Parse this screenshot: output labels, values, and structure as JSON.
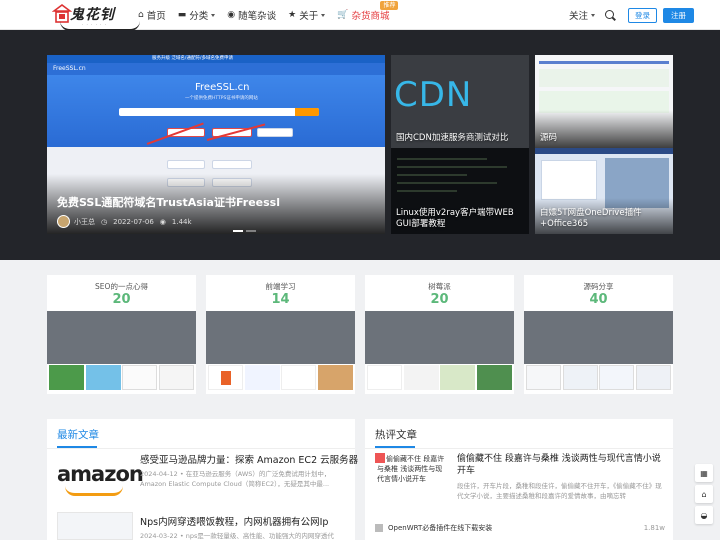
{
  "header": {
    "brand": "鬼花钊",
    "brand_sub": "· · · · · ·",
    "nav": [
      {
        "label": "首页",
        "icon": "home-icon",
        "glyph": "⌂"
      },
      {
        "label": "分类",
        "icon": "folder-icon",
        "glyph": "▬"
      },
      {
        "label": "随笔杂谈",
        "icon": "compass-icon",
        "glyph": "◉"
      },
      {
        "label": "关于",
        "icon": "star-icon",
        "glyph": "★"
      },
      {
        "label": "杂货商城",
        "icon": "cart-icon",
        "glyph": "🛒",
        "badge": "推荐"
      }
    ],
    "follow_label": "关注",
    "login_label": "登录",
    "register_label": "注册"
  },
  "hero": {
    "main": {
      "title": "免费SSL通配符域名TrustAsia证书Freessl",
      "author": "小王总",
      "date": "2022-07-06",
      "views": "1.44k",
      "site_name": "FreeSSL.cn",
      "banner_title": "FreeSSL.cn",
      "banner_tagline": "一个提供免费HTTPS证书申请的网站",
      "topbar_text": "服务升级 泛域名/通配符/多域名免费申请"
    },
    "tiles": [
      {
        "caption": "国内CDN加速服务商测试对比",
        "logo_text": "CDN"
      },
      {
        "caption": "源码"
      },
      {
        "caption": "Linux使用v2ray客户端带WEB GUI部署教程"
      },
      {
        "caption": "白嫖5T网盘OneDrive插件+Office365"
      }
    ]
  },
  "categories": [
    {
      "name": "SEO的一点心得",
      "count": "20"
    },
    {
      "name": "前端学习",
      "count": "14"
    },
    {
      "name": "树莓派",
      "count": "20"
    },
    {
      "name": "源码分享",
      "count": "40"
    }
  ],
  "latest": {
    "title": "最新文章",
    "items": [
      {
        "title": "感受亚马逊品牌力量：探索 Amazon EC2 云服务器",
        "meta": "2024-04-12 • 在亚马逊云服务（AWS）的广泛免费试用计划中，Amazon Elastic Compute Cloud（简称EC2），无疑是其中最...",
        "logo_word": "amazon"
      },
      {
        "title": "Nps内网穿透喂饭教程，内网机器拥有公网Ip",
        "meta": "2024-03-22 • nps是一款轻量级、高性能、功能强大的内网穿透代"
      }
    ]
  },
  "hot": {
    "title": "热评文章",
    "featured_thumb": "偷偷藏不住 段嘉许与桑椎 浅谈两性与现代言情小说开车",
    "featured_title": "偷偷藏不住 段嘉许与桑椎 浅谈两性与现代言情小说开车",
    "featured_desc": "段佳许，开车片段，桑稚和段佳许，偷偷藏不住开车，《偷偷藏不住》现代文学小说，主要描述桑稚和段嘉许的爱情故事，由嘀忘转",
    "rows": [
      {
        "title": "OpenWRT必备插件在线下载安装",
        "views": "1.81w"
      }
    ]
  },
  "floats": [
    {
      "icon": "qr-code-icon",
      "glyph": "▦"
    },
    {
      "icon": "home-icon",
      "glyph": "⌂"
    },
    {
      "icon": "qq-icon",
      "glyph": "◒"
    }
  ]
}
